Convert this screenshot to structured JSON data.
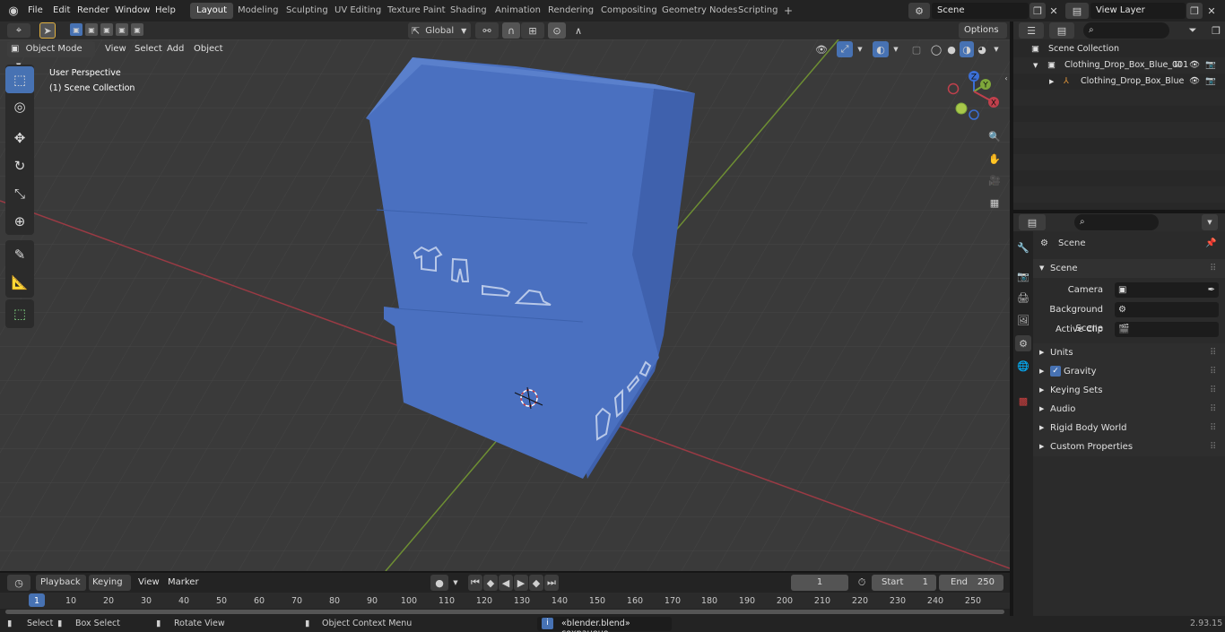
{
  "topbar": {
    "menus": [
      "File",
      "Edit",
      "Render",
      "Window",
      "Help"
    ],
    "workspaces": [
      "Layout",
      "Modeling",
      "Sculpting",
      "UV Editing",
      "Texture Paint",
      "Shading",
      "Animation",
      "Rendering",
      "Compositing",
      "Geometry Nodes",
      "Scripting"
    ],
    "active_workspace": "Layout",
    "add_workspace": "+",
    "scene_name": "Scene",
    "view_layer": "View Layer"
  },
  "viewport": {
    "mode": "Object Mode",
    "menus": [
      "View",
      "Select",
      "Add",
      "Object"
    ],
    "transform_orientation": "Global",
    "options_label": "Options",
    "overlay_title": "User Perspective",
    "overlay_collection": "(1) Scene Collection",
    "gizmo": {
      "x": "X",
      "y": "Y",
      "z": "Z"
    }
  },
  "outliner": {
    "search_placeholder": "",
    "root": "Scene Collection",
    "items": [
      {
        "label": "Clothing_Drop_Box_Blue_001"
      },
      {
        "label": "Clothing_Drop_Box_Blue"
      }
    ]
  },
  "properties": {
    "context": "Scene",
    "panel_title": "Scene",
    "fields": [
      {
        "label": "Camera"
      },
      {
        "label": "Background Scene"
      },
      {
        "label": "Active Clip"
      }
    ],
    "sections": [
      "Units",
      "Gravity",
      "Keying Sets",
      "Audio",
      "Rigid Body World",
      "Custom Properties"
    ],
    "gravity_checked": true
  },
  "timeline": {
    "menus": [
      "Playback",
      "Keying",
      "View",
      "Marker"
    ],
    "current_frame": "1",
    "start_label": "Start",
    "start_value": "1",
    "end_label": "End",
    "end_value": "250",
    "ruler": [
      "1",
      "10",
      "20",
      "30",
      "40",
      "50",
      "60",
      "70",
      "80",
      "90",
      "100",
      "110",
      "120",
      "130",
      "140",
      "150",
      "160",
      "170",
      "180",
      "190",
      "200",
      "210",
      "220",
      "230",
      "240",
      "250"
    ]
  },
  "statusbar": {
    "select": "Select",
    "box_select": "Box Select",
    "rotate_view": "Rotate View",
    "context_menu": "Object Context Menu",
    "message": "«blender.blend» сохранено",
    "version": "2.93.15"
  },
  "colors": {
    "accent": "#4772b3",
    "box_blue": "#4a70c0",
    "x_axis": "#c0404c",
    "y_axis": "#7ea73a"
  }
}
